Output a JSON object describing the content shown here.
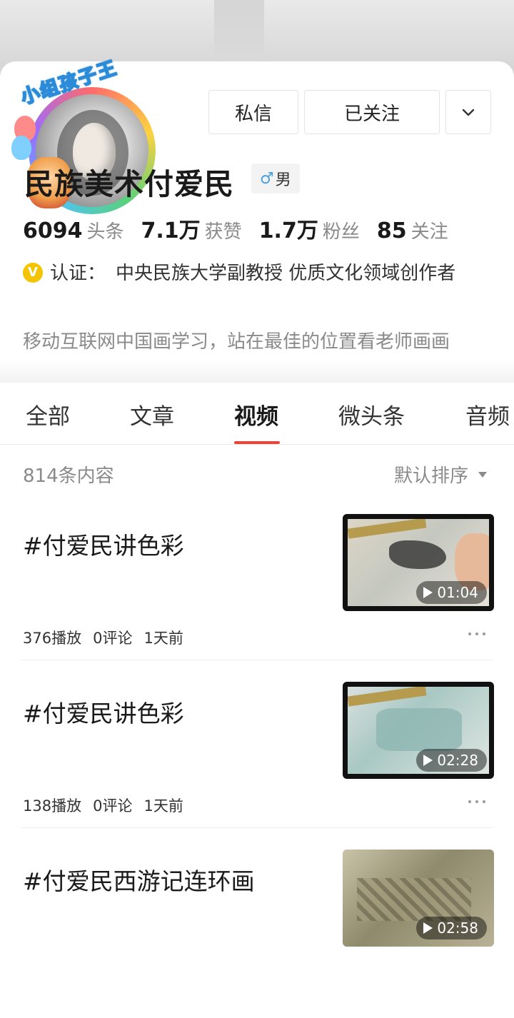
{
  "profile": {
    "avatar_badge": "小组孩子王",
    "name": "民族美术付爱民",
    "gender": "男",
    "gender_symbol": "♂",
    "buttons": {
      "message": "私信",
      "follow": "已关注"
    },
    "stats": [
      {
        "num": "6094",
        "label": "头条"
      },
      {
        "num": "7.1万",
        "label": "获赞"
      },
      {
        "num": "1.7万",
        "label": "粉丝"
      },
      {
        "num": "85",
        "label": "关注"
      }
    ],
    "verify_badge": "V",
    "verify_label": "认证：",
    "verify_text": "中央民族大学副教授 优质文化领域创作者",
    "bio": "移动互联网中国画学习，站在最佳的位置看老师画画"
  },
  "tabs": [
    "全部",
    "文章",
    "视频",
    "微头条",
    "音频"
  ],
  "active_tab": "视频",
  "list": {
    "count": "814条内容",
    "sort": "默认排序",
    "items": [
      {
        "title": "#付爱民讲色彩",
        "plays": "376播放",
        "comments": "0评论",
        "time": "1天前",
        "duration": "01:04"
      },
      {
        "title": "#付爱民讲色彩",
        "plays": "138播放",
        "comments": "0评论",
        "time": "1天前",
        "duration": "02:28"
      },
      {
        "title": "#付爱民西游记连环画",
        "plays": "",
        "comments": "",
        "time": "",
        "duration": "02:58"
      }
    ]
  },
  "colors": {
    "accent": "#e8453c",
    "verify": "#f5c400",
    "gender": "#4a9fe0"
  }
}
